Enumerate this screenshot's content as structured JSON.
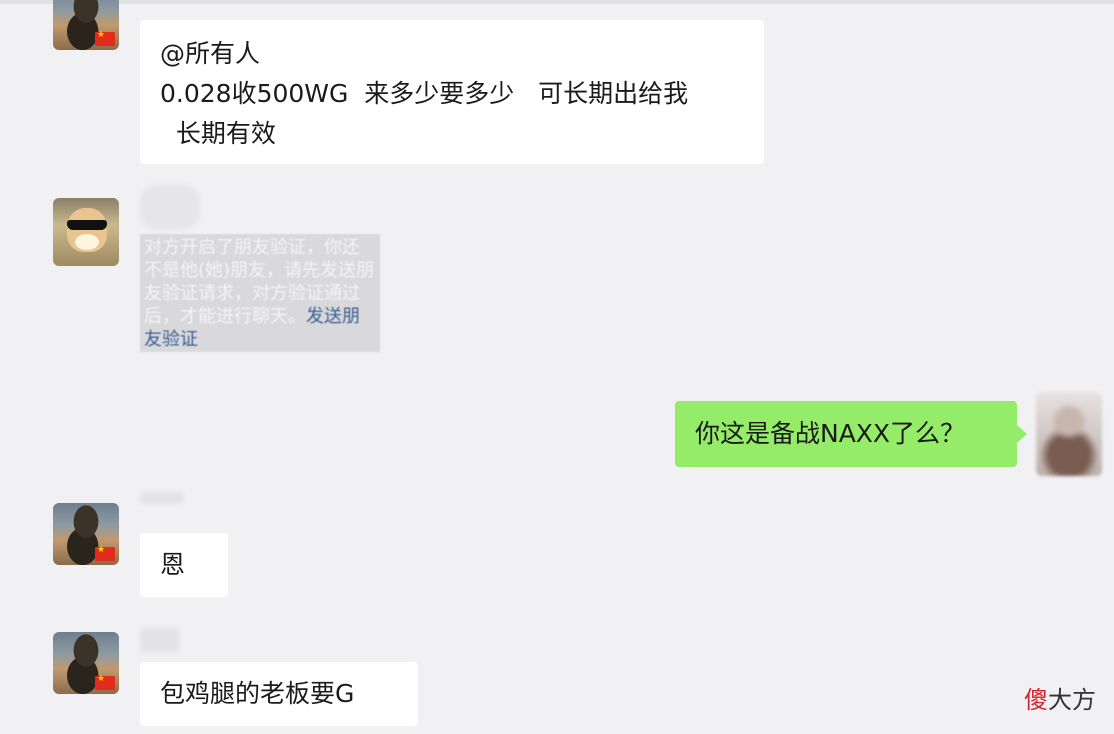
{
  "chat": {
    "messages": [
      {
        "id": "m1",
        "side": "left",
        "lines": [
          "@所有人",
          "0.028收500WG  来多少要多少   可长期出给我",
          "  长期有效"
        ]
      },
      {
        "id": "m2",
        "side": "left",
        "system_text": "对方开启了朋友验证，你还不是他(她)朋友，请先发送朋友验证请求，对方验证通过后，才能进行聊天。",
        "system_link": "发送朋友验证"
      },
      {
        "id": "m3",
        "side": "right",
        "text": "你这是备战NAXX了么？"
      },
      {
        "id": "m4",
        "side": "left",
        "text": "恩"
      },
      {
        "id": "m5",
        "side": "left",
        "text": "包鸡腿的老板要G"
      }
    ]
  },
  "watermark": {
    "red": "傻",
    "black": "大方"
  },
  "icons": {
    "flag": "china-flag-icon"
  }
}
